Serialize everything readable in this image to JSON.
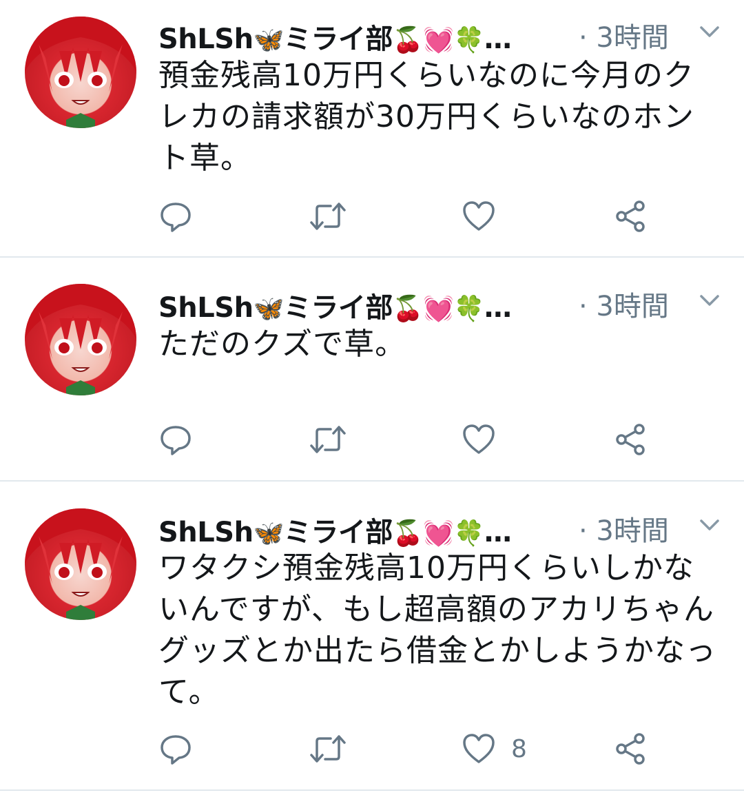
{
  "tweets": [
    {
      "display_name": "ShLSh",
      "name_suffix": "ミライ部",
      "emojis": [
        "🦋",
        "🍒",
        "💓",
        "🍀"
      ],
      "ellipsis": "…",
      "time": "· 3時間",
      "text": "預金残高10万円くらいなのに今月のクレカの請求額が30万円くらいなのホント草。",
      "like_count": ""
    },
    {
      "display_name": "ShLSh",
      "name_suffix": "ミライ部",
      "emojis": [
        "🦋",
        "🍒",
        "💓",
        "🍀"
      ],
      "ellipsis": "…",
      "time": "· 3時間",
      "text": "ただのクズで草。",
      "like_count": ""
    },
    {
      "display_name": "ShLSh",
      "name_suffix": "ミライ部",
      "emojis": [
        "🦋",
        "🍒",
        "💓",
        "🍀"
      ],
      "ellipsis": "…",
      "time": "· 3時間",
      "text": "ワタクシ預金残高10万円くらいしかないんですが、もし超高額のアカリちゃんグッズとか出たら借金とかしようかなって。",
      "like_count": "8"
    }
  ],
  "icons": {
    "reply": "reply-icon",
    "retweet": "retweet-icon",
    "like": "heart-icon",
    "share": "share-icon",
    "caret": "chevron-down-icon",
    "avatar": "avatar"
  },
  "colors": {
    "text": "#14171a",
    "secondary": "#657786",
    "icon": "#657786",
    "divider": "#e1e8ed"
  }
}
